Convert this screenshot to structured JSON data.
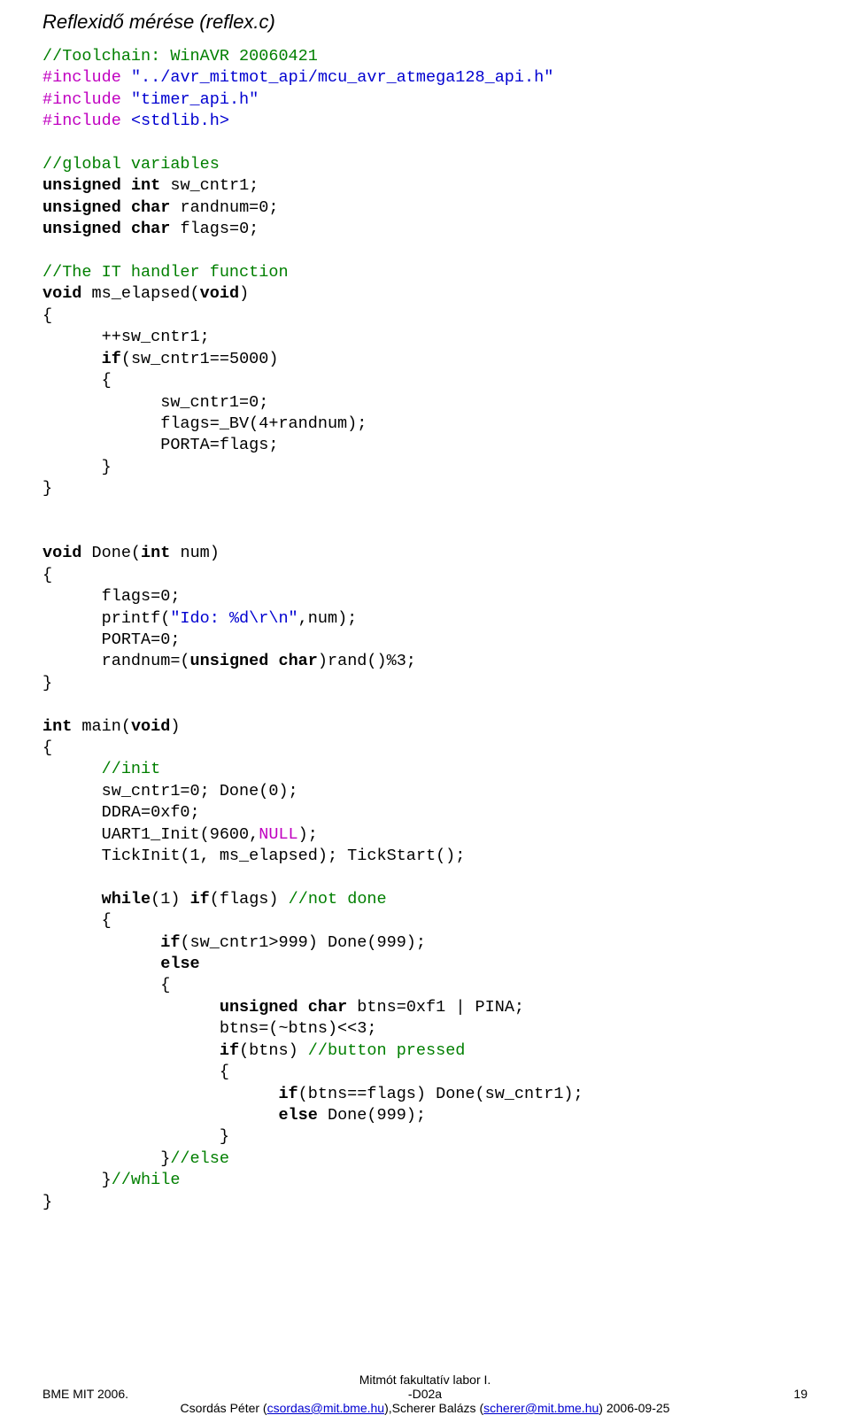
{
  "title": "Reflexidő mérése (reflex.c)",
  "code": {
    "l1": "//Toolchain: WinAVR 20060421",
    "l2a": "#include",
    "l2b": "\"../avr_mitmot_api/mcu_avr_atmega128_api.h\"",
    "l3a": "#include",
    "l3b": "\"timer_api.h\"",
    "l4a": "#include",
    "l4b": "<stdlib.h>",
    "l5": "//global variables",
    "l6a": "unsigned",
    "l6b": "int",
    "l6c": "sw_cntr1;",
    "l7a": "unsigned",
    "l7b": "char",
    "l7c": "randnum=0;",
    "l8a": "unsigned",
    "l8b": "char",
    "l8c": "flags=0;",
    "l9": "//The IT handler function",
    "l10a": "void",
    "l10b": "ms_elapsed(",
    "l10c": "void",
    "l10d": ")",
    "l11": "{",
    "l12": "      ++sw_cntr1;",
    "l13a": "      ",
    "l13b": "if",
    "l13c": "(sw_cntr1==5000)",
    "l14": "      {",
    "l15": "            sw_cntr1=0;",
    "l16": "            flags=_BV(4+randnum);",
    "l17": "            PORTA=flags;",
    "l18": "      }",
    "l19": "}",
    "l20a": "void",
    "l20b": " Done(",
    "l20c": "int",
    "l20d": " num)",
    "l21": "{",
    "l22": "      flags=0;",
    "l23a": "      printf(",
    "l23b": "\"Ido: %d\\r\\n\"",
    "l23c": ",num);",
    "l24": "      PORTA=0;",
    "l25a": "      randnum=(",
    "l25b": "unsigned",
    "l25c": " ",
    "l25d": "char",
    "l25e": ")rand()%3;",
    "l26": "}",
    "l27a": "int",
    "l27b": " main(",
    "l27c": "void",
    "l27d": ")",
    "l28": "{",
    "l29a": "      ",
    "l29b": "//init",
    "l30": "      sw_cntr1=0; Done(0);",
    "l31": "      DDRA=0xf0;",
    "l32a": "      UART1_Init(9600,",
    "l32b": "NULL",
    "l32c": ");",
    "l33": "      TickInit(1, ms_elapsed); TickStart();",
    "l34a": "      ",
    "l34b": "while",
    "l34c": "(1) ",
    "l34d": "if",
    "l34e": "(flags) ",
    "l34f": "//not done",
    "l35": "      {",
    "l36a": "            ",
    "l36b": "if",
    "l36c": "(sw_cntr1>999) Done(999);",
    "l37a": "            ",
    "l37b": "else",
    "l38": "            {",
    "l39a": "                  ",
    "l39b": "unsigned",
    "l39c": " ",
    "l39d": "char",
    "l39e": " btns=0xf1 | PINA;",
    "l40": "                  btns=(~btns)<<3;",
    "l41a": "                  ",
    "l41b": "if",
    "l41c": "(btns) ",
    "l41d": "//button pressed",
    "l42": "                  {",
    "l43a": "                        ",
    "l43b": "if",
    "l43c": "(btns==flags) Done(sw_cntr1);",
    "l44a": "                        ",
    "l44b": "else",
    "l44c": " Done(999);",
    "l45": "                  }",
    "l46a": "            }",
    "l46b": "//else",
    "l47a": "      }",
    "l47b": "//while",
    "l48": "}"
  },
  "footer": {
    "line1": "Mitmót fakultatív labor I.",
    "left": "BME MIT 2006.",
    "center": "-D02a",
    "right": "19",
    "line3a": "Csordás Péter (",
    "email1": "csordas@mit.bme.hu",
    "line3b": "),Scherer Balázs (",
    "email2": "scherer@mit.bme.hu",
    "line3c": ")  2006-09-25"
  }
}
